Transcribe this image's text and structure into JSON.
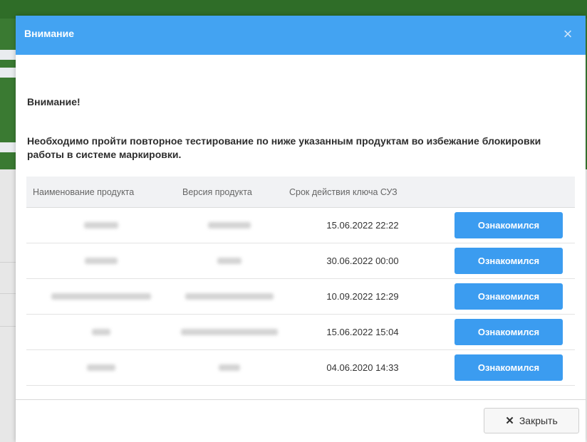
{
  "modal": {
    "title": "Внимание",
    "close_icon": "×",
    "heading": "Внимание!",
    "message": "Необходимо пройти повторное тестирование по ниже указанным продуктам во избежание блокировки работы в системе маркировки.",
    "footer_close_label": "Закрыть",
    "footer_close_icon": "✕"
  },
  "table": {
    "headers": [
      "Наименование продукта",
      "Версия продукта",
      "Срок действия ключа СУЗ",
      ""
    ],
    "rows": [
      {
        "expiry": "15.06.2022 22:22",
        "action": "Ознакомился"
      },
      {
        "expiry": "30.06.2022 00:00",
        "action": "Ознакомился"
      },
      {
        "expiry": "10.09.2022 12:29",
        "action": "Ознакомился"
      },
      {
        "expiry": "15.06.2022 15:04",
        "action": "Ознакомился"
      },
      {
        "expiry": "04.06.2020 14:33",
        "action": "Ознакомился"
      }
    ]
  },
  "colors": {
    "header_bg": "#43a3f2",
    "button_bg": "#3b9cf0",
    "background_banner": "#3a7a32"
  },
  "icons": {
    "modal_close": "close-icon",
    "footer_close": "x-icon"
  }
}
